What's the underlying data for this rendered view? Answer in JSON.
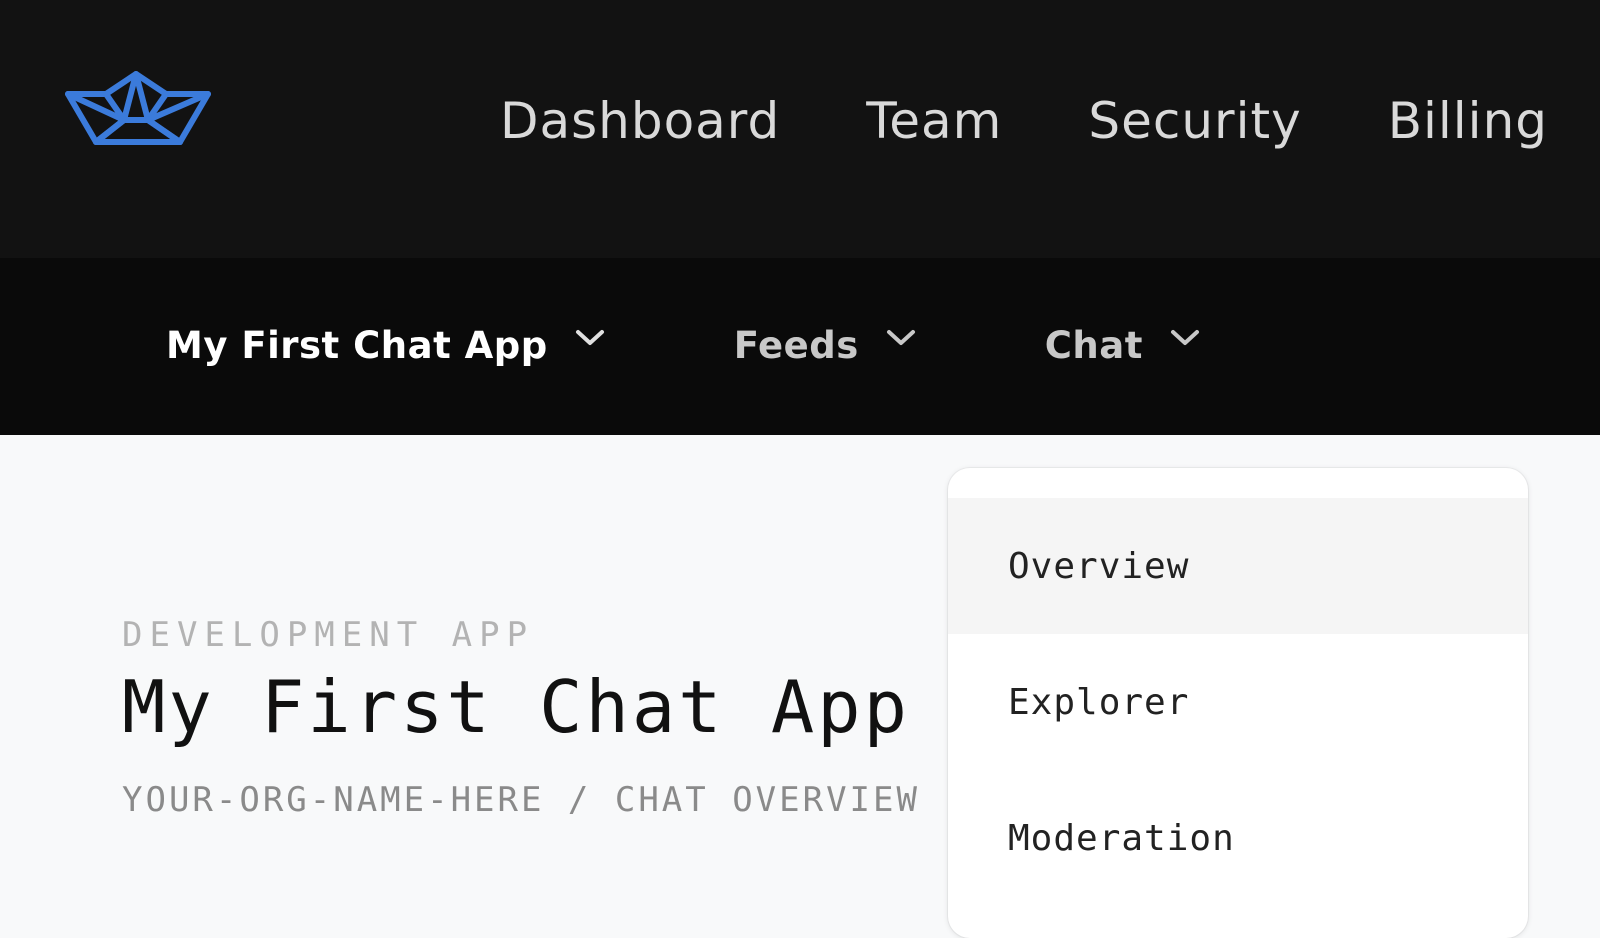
{
  "brand": {
    "logo_icon": "paper-boat-icon",
    "accent": "#3b7bdb"
  },
  "main_nav": [
    {
      "label": "Dashboard"
    },
    {
      "label": "Team"
    },
    {
      "label": "Security"
    },
    {
      "label": "Billing"
    }
  ],
  "sub_nav": [
    {
      "label": "My First Chat App",
      "icon": "chevron-down-icon",
      "active": true
    },
    {
      "label": "Feeds",
      "icon": "chevron-down-icon",
      "active": false
    },
    {
      "label": "Chat",
      "icon": "chevron-down-icon",
      "active": false
    }
  ],
  "header": {
    "app_type": "DEVELOPMENT APP",
    "title": "My First Chat App",
    "breadcrumb": "YOUR-ORG-NAME-HERE / CHAT OVERVIEW"
  },
  "chat_menu": {
    "items": [
      {
        "label": "Overview",
        "highlighted": true
      },
      {
        "label": "Explorer",
        "highlighted": false
      },
      {
        "label": "Moderation",
        "highlighted": false
      }
    ]
  }
}
